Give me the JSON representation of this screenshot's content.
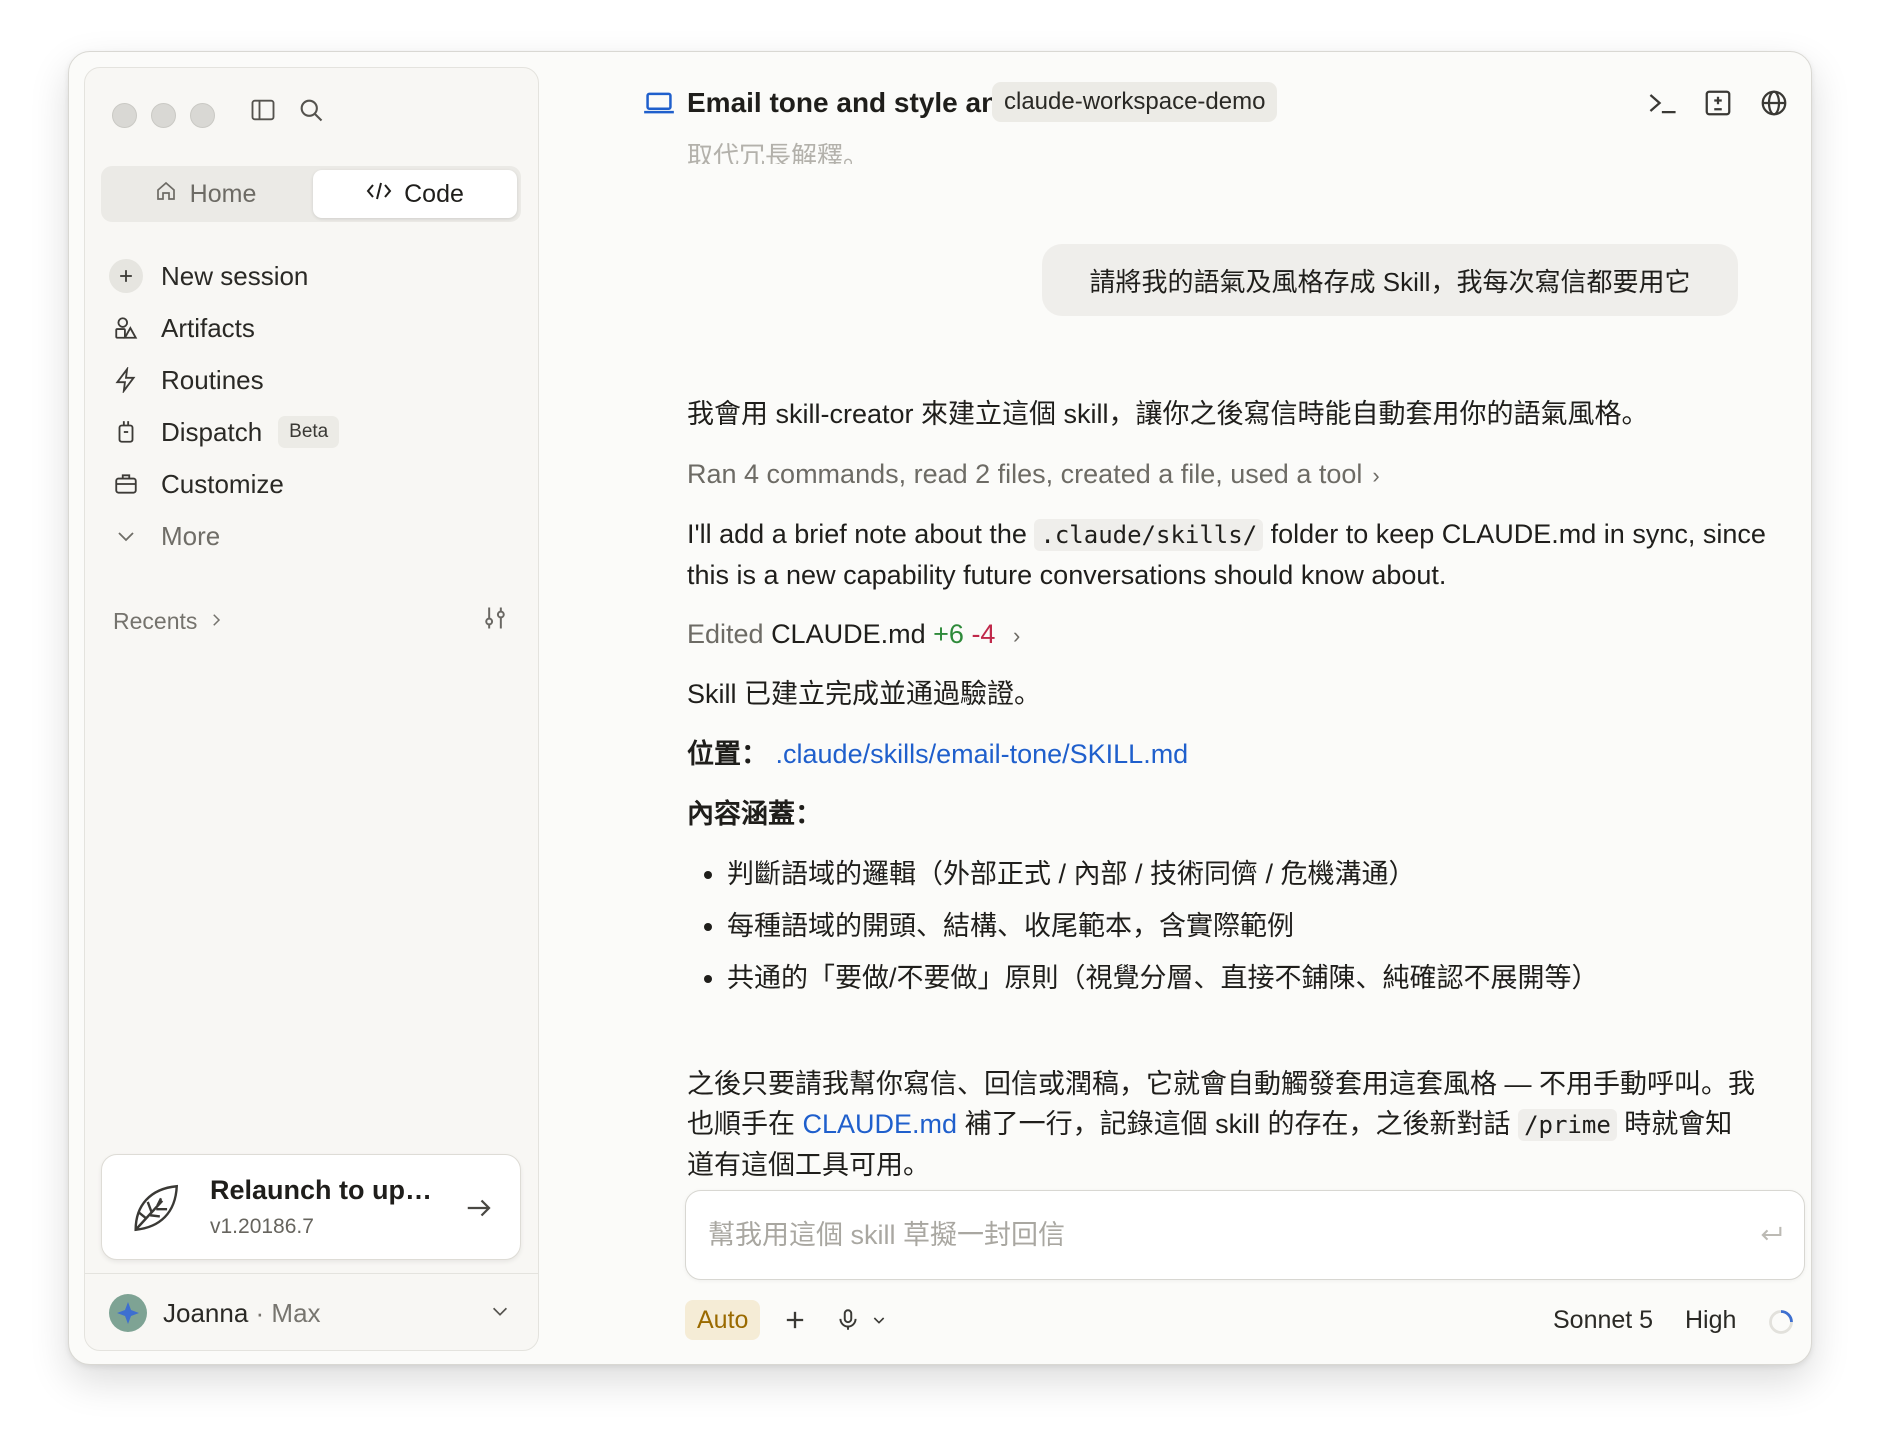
{
  "sidebar": {
    "segments": {
      "home": "Home",
      "code": "Code"
    },
    "nav": {
      "new_session": "New session",
      "artifacts": "Artifacts",
      "routines": "Routines",
      "dispatch": "Dispatch",
      "dispatch_badge": "Beta",
      "customize": "Customize",
      "more": "More"
    },
    "recents": "Recents",
    "update": {
      "title": "Relaunch to up…",
      "version": "v1.20186.7"
    },
    "user": {
      "name": "Joanna",
      "separator": " · ",
      "plan": "Max"
    }
  },
  "header": {
    "title": "Email tone and style analysis",
    "workspace": "claude-workspace-demo"
  },
  "conversation": {
    "faded_text": "取代冗長解釋。",
    "user_message": "請將我的語氣及風格存成 Skill，我每次寫信都要用它",
    "intro": "我會用 skill-creator 來建立這個 skill，讓你之後寫信時能自動套用你的語氣風格。",
    "tool_summary": "Ran 4 commands, read 2 files, created a file, used a tool",
    "note_pre": "I'll add a brief note about the ",
    "note_code": ".claude/skills/",
    "note_post": " folder to keep CLAUDE.md in sync, since this is a new capability future conversations should know about.",
    "edit_label": "Edited ",
    "edit_file": "CLAUDE.md",
    "edit_add": "+6",
    "edit_del": "-4",
    "done": "Skill 已建立完成並通過驗證。",
    "location_label": "位置：",
    "location_link": ".claude/skills/email-tone/SKILL.md",
    "contents_label": "內容涵蓋：",
    "bullets": [
      "判斷語域的邏輯（外部正式 / 內部 / 技術同儕 / 危機溝通）",
      "每種語域的開頭、結構、收尾範本，含實際範例",
      "共通的「要做/不要做」原則（視覺分層、直接不鋪陳、純確認不展開等）"
    ],
    "closing_1": "之後只要請我幫你寫信、回信或潤稿，它就會自動觸發套用這套風格 — 不用手動呼叫。我",
    "closing_2_pre": "也順手在 ",
    "closing_2_link": "CLAUDE.md",
    "closing_2_mid": " 補了一行，記錄這個 skill 的存在，之後新對話 ",
    "closing_2_code": "/prime",
    "closing_2_post": " 時就會知",
    "closing_3": "道有這個工具可用。"
  },
  "composer": {
    "placeholder": "幫我用這個 skill 草擬一封回信",
    "mode": "Auto",
    "model": "Sonnet 5",
    "effort": "High"
  },
  "colors": {
    "accent_blue": "#1f5fcc",
    "diff_add": "#2e8a3a",
    "diff_del": "#c0284a",
    "auto_chip_bg": "#f5ecd6",
    "auto_chip_text": "#9a6a00"
  },
  "icons": [
    "sidebar-toggle-icon",
    "search-icon",
    "home-icon",
    "code-icon",
    "plus-icon",
    "artifacts-icon",
    "bolt-icon",
    "dispatch-icon",
    "briefcase-icon",
    "chevron-down-icon",
    "chevron-right-icon",
    "sliders-icon",
    "leaf-icon",
    "arrow-right-icon",
    "laptop-icon",
    "terminal-icon",
    "diff-icon",
    "globe-icon",
    "more-vertical-icon",
    "enter-icon",
    "mic-icon",
    "spinner-icon"
  ]
}
